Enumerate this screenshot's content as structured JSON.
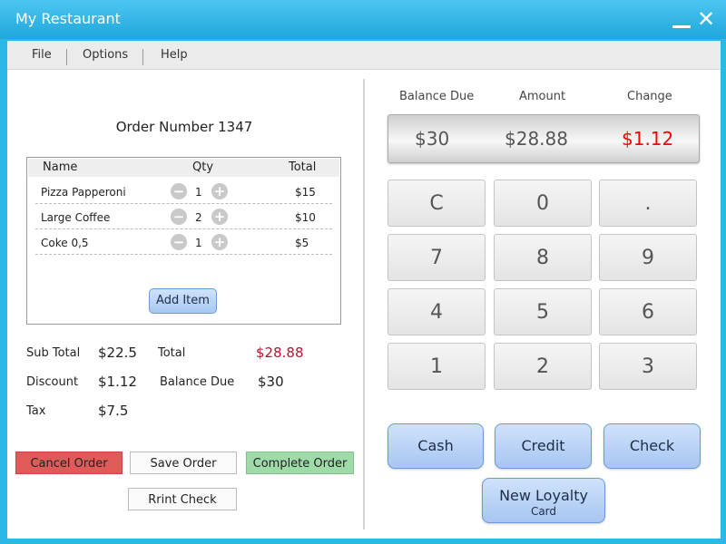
{
  "window": {
    "title": "My Restaurant"
  },
  "menu": {
    "items": [
      "File",
      "Options",
      "Help"
    ]
  },
  "order": {
    "number_label": "Order Number 1347",
    "columns": {
      "name": "Name",
      "qty": "Qty",
      "total": "Total"
    },
    "items": [
      {
        "name": "Pizza Papperoni",
        "qty": "1",
        "total": "$15"
      },
      {
        "name": "Large Coffee",
        "qty": "2",
        "total": "$10"
      },
      {
        "name": "Coke 0,5",
        "qty": "1",
        "total": "$5"
      }
    ],
    "add_item_label": "Add Item"
  },
  "summary": {
    "subtotal_label": "Sub Total",
    "subtotal_value": "$22.5",
    "discount_label": "Discount",
    "discount_value": "$1.12",
    "tax_label": "Tax",
    "tax_value": "$7.5",
    "total_label": "Total",
    "total_value": "$28.88",
    "balance_label": "Balance Due",
    "balance_value": "$30"
  },
  "actions": {
    "cancel": "Cancel Order",
    "save": "Save Order",
    "complete": "Complete Order",
    "print": "Rrint Check"
  },
  "calculator": {
    "labels": {
      "balance": "Balance Due",
      "amount": "Amount",
      "change": "Change"
    },
    "display": {
      "balance": "$30",
      "amount": "$28.88",
      "change": "$1.12"
    },
    "keys": [
      "C",
      "0",
      ".",
      "7",
      "8",
      "9",
      "4",
      "5",
      "6",
      "1",
      "2",
      "3"
    ]
  },
  "payment": {
    "cash": "Cash",
    "credit": "Credit",
    "check": "Check",
    "loyalty_line1": "New Loyalty",
    "loyalty_line2": "Card"
  },
  "colors": {
    "titlebar": "#1fa7dc",
    "total_red": "#b5172c",
    "change_red": "#ff0000",
    "cancel_bg": "#e05a5a",
    "complete_bg": "#9fdba9",
    "button_blue": "#a9c8f2"
  }
}
